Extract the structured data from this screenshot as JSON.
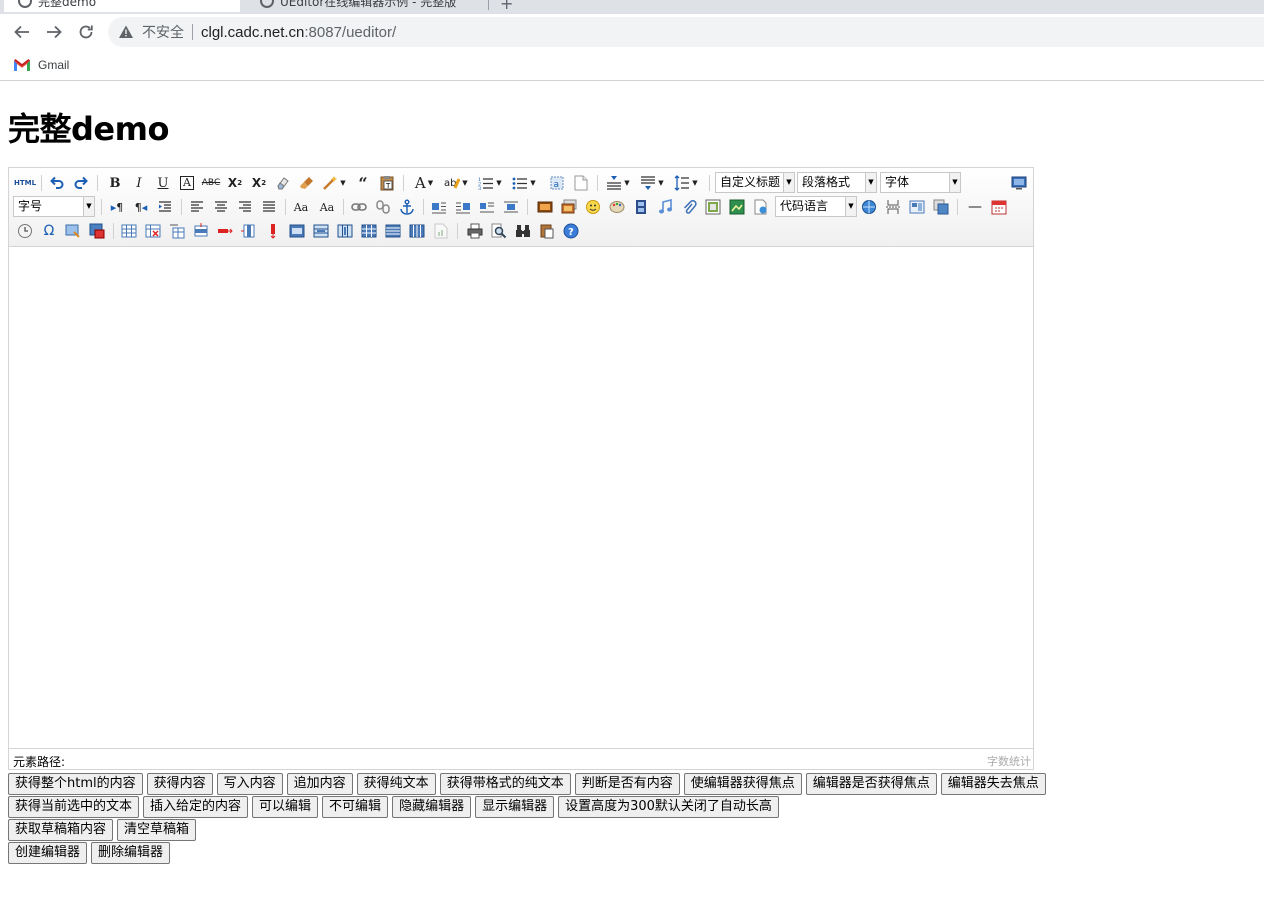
{
  "browser": {
    "tabs": [
      {
        "title": "完整demo",
        "active": true
      },
      {
        "title": "UEditor在线编辑器示例 - 完整版",
        "active": false
      }
    ],
    "address": {
      "security_label": "不安全",
      "host": "clgl.cadc.net.cn",
      "path": ":8087/ueditor/"
    },
    "bookmarks": [
      {
        "label": "Gmail"
      }
    ]
  },
  "page": {
    "title": "完整demo"
  },
  "editor": {
    "toolbar": {
      "selects": {
        "custom_title": "自定义标题",
        "paragraph": "段落格式",
        "font_family": "字体",
        "font_size": "字号",
        "code_lang": "代码语言"
      },
      "html_label": "HTML"
    },
    "status": {
      "element_path": "元素路径:",
      "word_count": "字数统计"
    }
  },
  "buttons": {
    "row1": [
      "获得整个html的内容",
      "获得内容",
      "写入内容",
      "追加内容",
      "获得纯文本",
      "获得带格式的纯文本",
      "判断是否有内容",
      "使编辑器获得焦点",
      "编辑器是否获得焦点",
      "编辑器失去焦点"
    ],
    "row2": [
      "获得当前选中的文本",
      "插入给定的内容",
      "可以编辑",
      "不可编辑",
      "隐藏编辑器",
      "显示编辑器",
      "设置高度为300默认关闭了自动长高"
    ],
    "row3": [
      "获取草稿箱内容",
      "清空草稿箱"
    ],
    "row4": [
      "创建编辑器",
      "删除编辑器"
    ]
  }
}
